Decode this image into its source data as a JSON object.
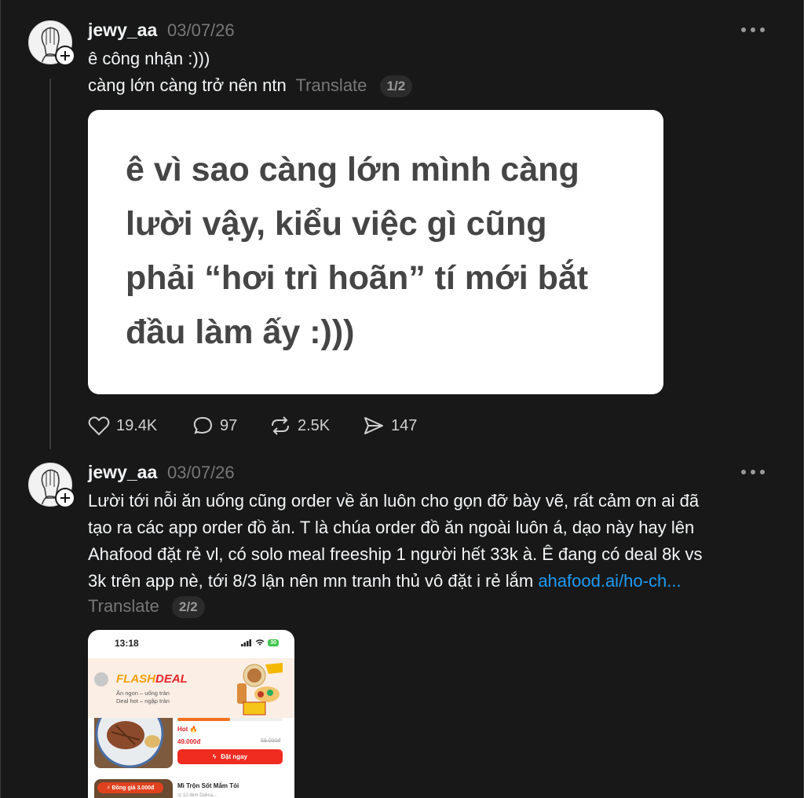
{
  "posts": [
    {
      "username": "jewy_aa",
      "date": "03/07/26",
      "lines": [
        "ê công nhận :)))",
        "càng lớn càng trở nên ntn"
      ],
      "translate": "Translate",
      "pager": "1/2",
      "quote_image": {
        "lines": [
          "ê vì sao càng lớn mình càng",
          "lười vậy, kiểu việc gì cũng",
          "phải “hơi trì hoãn” tí mới bắt",
          "đầu làm ấy :)))"
        ]
      },
      "actions": {
        "likes": "19.4K",
        "replies": "97",
        "reposts": "2.5K",
        "shares": "147"
      }
    },
    {
      "username": "jewy_aa",
      "date": "03/07/26",
      "lines": [
        "Lười tới nỗi ăn uống cũng order về ăn luôn cho gọn đỡ bày vẽ, rất cảm ơn ai đã",
        "tạo ra các app order đồ ăn. T là chúa order đồ ăn ngoài luôn á, dạo này hay lên",
        "Ahafood đặt rẻ vl, có solo meal freeship 1 người hết 33k à. Ê đang có deal 8k vs",
        "3k trên app nè, tới 8/3 lận nên mn tranh thủ vô đặt i rẻ lắm "
      ],
      "link": "ahafood.ai/ho-ch...",
      "translate": "Translate",
      "pager": "2/2",
      "screenshot": {
        "time": "13:18",
        "battery": "30",
        "flash": "FLASH",
        "deal": "DEAL",
        "sub1": "Ăn ngon – uống tràn",
        "sub2": "Deal hot – ngập tràn",
        "hot": "Hot 🔥",
        "price": "49.000đ",
        "old_price": "59.000đ",
        "button": "Đặt ngay",
        "progress": 0.5,
        "tag": "⚡ Đồng giá 3.000đ",
        "item_name": "Mì Trộn Sốt Mắm Tỏi",
        "item_meta": "◎ 12.4km  Delica..."
      }
    }
  ]
}
